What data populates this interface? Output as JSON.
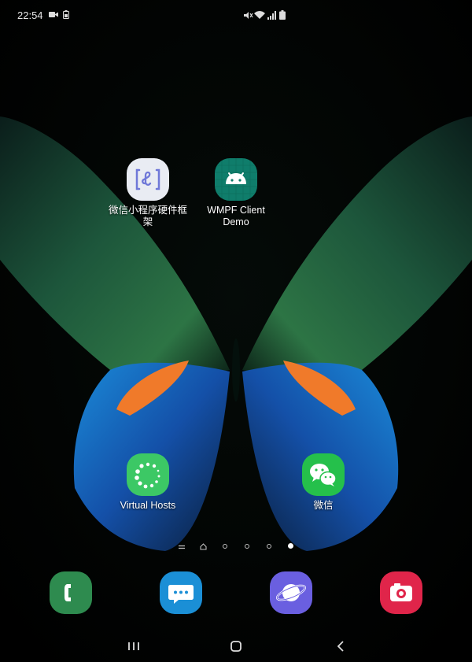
{
  "status_bar": {
    "time": "22:54",
    "left_icons": [
      "video-camera-icon",
      "battery-saver-icon"
    ],
    "right_icons": [
      "mute-icon",
      "wifi-icon",
      "signal-icon",
      "battery-icon"
    ]
  },
  "apps": [
    {
      "label": "微信小程序硬件框架",
      "icon": "mini-program-icon"
    },
    {
      "label": "WMPF Client Demo",
      "icon": "android-icon"
    },
    {
      "label": "Virtual Hosts",
      "icon": "virtual-hosts-icon"
    },
    {
      "label": "微信",
      "icon": "wechat-icon"
    }
  ],
  "page_indicator": {
    "pages": 5,
    "active_page": 5,
    "items": [
      "menu-icon",
      "home-icon",
      "dot",
      "dot",
      "dot",
      "dot"
    ]
  },
  "dock": [
    {
      "name": "phone",
      "icon": "phone-icon",
      "color": "#2e8b4f"
    },
    {
      "name": "messages",
      "icon": "messages-icon",
      "color": "#1b8fd6"
    },
    {
      "name": "internet",
      "icon": "internet-icon",
      "color": "#6a5fe0"
    },
    {
      "name": "camera",
      "icon": "camera-icon",
      "color": "#e0254a"
    }
  ],
  "nav_bar": {
    "buttons": [
      "recents-icon",
      "home-icon",
      "back-icon"
    ]
  }
}
